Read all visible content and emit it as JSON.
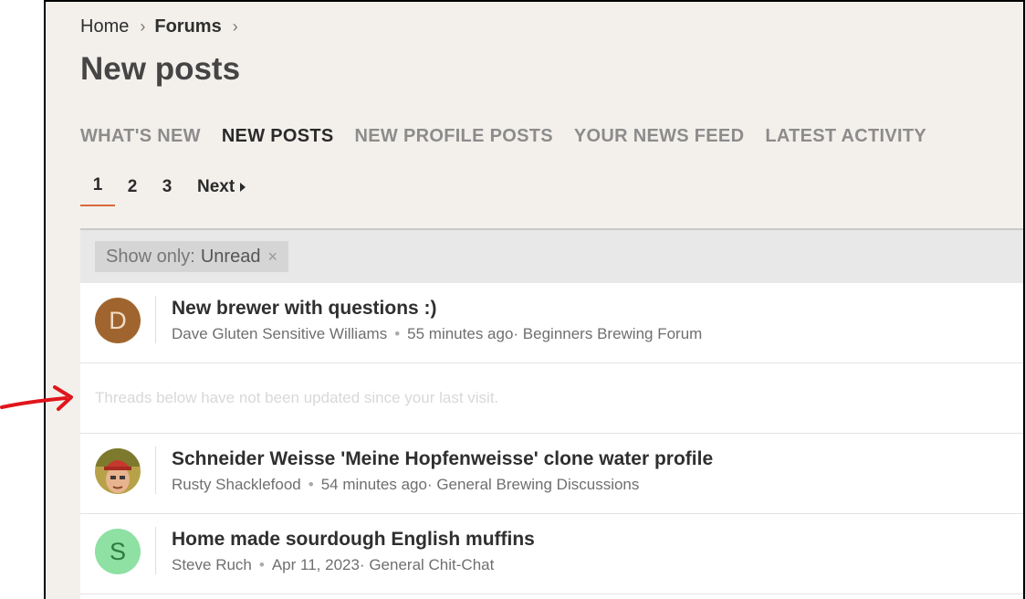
{
  "breadcrumb": {
    "home": "Home",
    "forums": "Forums"
  },
  "page_title": "New posts",
  "tabs": [
    {
      "label": "WHAT'S NEW",
      "active": false
    },
    {
      "label": "NEW POSTS",
      "active": true
    },
    {
      "label": "NEW PROFILE POSTS",
      "active": false
    },
    {
      "label": "YOUR NEWS FEED",
      "active": false
    },
    {
      "label": "LATEST ACTIVITY",
      "active": false
    }
  ],
  "pager": {
    "pages": [
      "1",
      "2",
      "3"
    ],
    "current": "1",
    "next_label": "Next"
  },
  "filter": {
    "label": "Show only:",
    "value": "Unread",
    "remove": "×"
  },
  "threads": [
    {
      "avatar_letter": "D",
      "avatar_color": "#a0652e",
      "avatar_text_color": "#f2dcc8",
      "title": "New brewer with questions :)",
      "author": "Dave Gluten Sensitive Williams",
      "time": "55 minutes ago",
      "forum": "· Beginners Brewing Forum"
    },
    {
      "avatar_letter": "",
      "avatar_color": "#9c8a3a",
      "title": "Schneider Weisse 'Meine Hopfenweisse' clone water profile",
      "author": "Rusty Shacklefood",
      "time": "54 minutes ago",
      "forum": "· General Brewing Discussions"
    },
    {
      "avatar_letter": "S",
      "avatar_color": "#8ee0a3",
      "avatar_text_color": "#2f7a43",
      "title": "Home made sourdough English muffins",
      "author": "Steve Ruch",
      "time": "Apr 11, 2023",
      "forum": "· General Chit-Chat"
    }
  ],
  "notice": "Threads below have not been updated since your last visit.",
  "annotation_arrow_color": "#e0151b",
  "accent_color": "#d9683a"
}
